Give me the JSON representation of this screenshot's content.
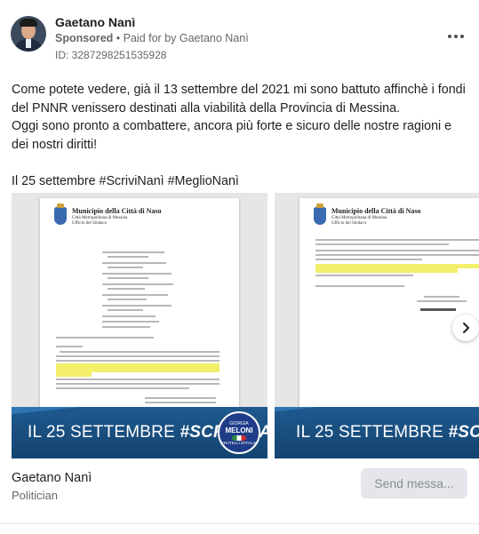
{
  "post": {
    "author": "Gaetano Nanì",
    "sponsored": "Sponsored",
    "paid_for": "• Paid for by Gaetano Nanì",
    "library_id": "ID: 3287298251535928",
    "paragraphs": [
      "Come potete vedere, già il 13 settembre del 2021 mi sono battuto affinchè i fondi del PNNR venissero destinati alla viabilità della Provincia di Messina.",
      "Oggi sono pronto a combattere, ancora più forte e sicuro delle nostre ragioni e dei nostri diritti!",
      "Il 25 settembre #ScriviNanì #MeglioNanì"
    ]
  },
  "slides": [
    {
      "munic_title": "Municipio della Città di Naso",
      "munic_sub1": "Città Metropolitana di Messina",
      "munic_sub2": "Ufficio del Sindaco",
      "banner_pre": "IL 25 SETTEMBRE ",
      "banner_tag": "#SCRIVINANÌ",
      "logo": {
        "l1": "GIORGIA",
        "l2": "MELONI",
        "l3": "FRATELLI D'ITALIA"
      }
    },
    {
      "munic_title": "Municipio della Città di Naso",
      "munic_sub1": "Città Metropolitana di Messina",
      "munic_sub2": "Ufficio del Sindaco",
      "banner_pre": "IL 25 SETTEMBRE ",
      "banner_tag": "#SCRIVINANÌ"
    }
  ],
  "footer": {
    "page_name": "Gaetano Nanì",
    "page_category": "Politician",
    "send_button": "Send messa..."
  },
  "icons": {
    "more": "more-options-icon",
    "next": "chevron-right-icon"
  },
  "colors": {
    "banner": "#1f5a8f",
    "highlight": "#f3ef6a",
    "button_bg": "#e4e6eb"
  }
}
